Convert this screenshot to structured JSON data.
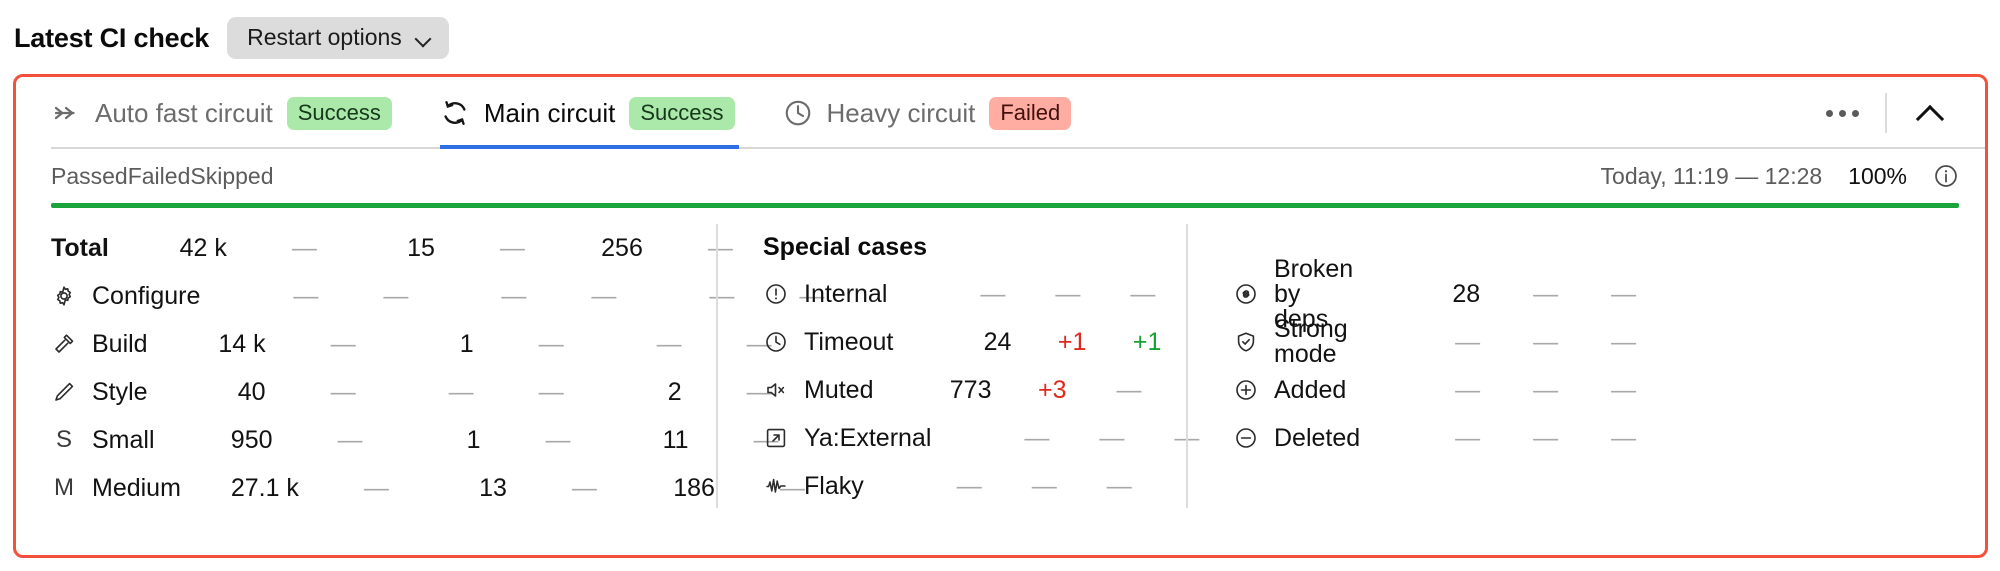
{
  "header": {
    "title": "Latest CI check",
    "restart_button": "Restart options",
    "chevron_icon": "chevron-down-icon"
  },
  "tabs": [
    {
      "label": "Auto fast circuit",
      "status": "Success",
      "status_type": "success",
      "icon": "double-chevron-right-icon",
      "active": false
    },
    {
      "label": "Main circuit",
      "status": "Success",
      "status_type": "success",
      "icon": "sync-circular-arrows-icon",
      "active": true
    },
    {
      "label": "Heavy circuit",
      "status": "Failed",
      "status_type": "failed",
      "icon": "clock-icon",
      "active": false
    }
  ],
  "tab_actions": {
    "more_icon": "more-horizontal-icon",
    "collapse_icon": "chevron-up-icon"
  },
  "meta": {
    "columns": [
      "Passed",
      "Failed",
      "Skipped"
    ],
    "time_range": "Today, 11:19 — 12:28",
    "percent": "100%",
    "info_icon": "info-circle-icon",
    "progress_color": "#19a33a",
    "progress_percent": 100
  },
  "colors": {
    "accent_border": "#f5503c",
    "active_tab": "#2f6fe4",
    "success_bg": "#abe9ab",
    "failed_bg": "#ffada3",
    "delta_up": "#e0281c",
    "delta_good": "#17a334"
  },
  "left_table": {
    "rows": [
      {
        "name": "Total",
        "icon": "",
        "letter": "",
        "bold": true,
        "cells": [
          "42 k",
          "—",
          "15",
          "—",
          "256",
          "—"
        ]
      },
      {
        "name": "Configure",
        "icon": "gear-icon",
        "letter": "",
        "bold": false,
        "cells": [
          "—",
          "—",
          "—",
          "—",
          "—",
          "—"
        ]
      },
      {
        "name": "Build",
        "icon": "hammer-icon",
        "letter": "",
        "bold": false,
        "cells": [
          "14 k",
          "—",
          "1",
          "—",
          "—",
          "—"
        ]
      },
      {
        "name": "Style",
        "icon": "pencil-icon",
        "letter": "",
        "bold": false,
        "cells": [
          "40",
          "—",
          "—",
          "—",
          "2",
          "—"
        ]
      },
      {
        "name": "Small",
        "icon": "",
        "letter": "S",
        "bold": false,
        "cells": [
          "950",
          "—",
          "1",
          "—",
          "11",
          "—"
        ]
      },
      {
        "name": "Medium",
        "icon": "",
        "letter": "M",
        "bold": false,
        "cells": [
          "27.1 k",
          "—",
          "13",
          "—",
          "186",
          "—"
        ]
      }
    ]
  },
  "special_cases": {
    "title": "Special cases",
    "rows": [
      {
        "name": "Internal",
        "icon": "exclamation-circle-icon",
        "cells": [
          "—",
          "—",
          "—"
        ],
        "cell_styles": [
          "dash",
          "dash",
          "dash"
        ]
      },
      {
        "name": "Timeout",
        "icon": "clock-icon",
        "cells": [
          "24",
          "+1",
          "+1"
        ],
        "cell_styles": [
          "",
          "pos-red",
          "pos-green"
        ]
      },
      {
        "name": "Muted",
        "icon": "speaker-mute-icon",
        "cells": [
          "773",
          "+3",
          "—"
        ],
        "cell_styles": [
          "",
          "pos-red",
          "dash"
        ]
      },
      {
        "name": "Ya:External",
        "icon": "external-link-icon",
        "cells": [
          "—",
          "—",
          "—"
        ],
        "cell_styles": [
          "dash",
          "dash",
          "dash"
        ]
      },
      {
        "name": "Flaky",
        "icon": "waveform-icon",
        "cells": [
          "—",
          "—",
          "—"
        ],
        "cell_styles": [
          "dash",
          "dash",
          "dash"
        ]
      }
    ]
  },
  "right_table": {
    "rows": [
      {
        "name": "Broken by deps",
        "icon": "link-chain-icon",
        "cells": [
          "28",
          "—",
          "—"
        ],
        "cell_styles": [
          "",
          "dash",
          "dash"
        ]
      },
      {
        "name": "Strong mode",
        "icon": "shield-check-icon",
        "cells": [
          "—",
          "—",
          "—"
        ],
        "cell_styles": [
          "dash",
          "dash",
          "dash"
        ]
      },
      {
        "name": "Added",
        "icon": "plus-circle-icon",
        "cells": [
          "—",
          "—",
          "—"
        ],
        "cell_styles": [
          "dash",
          "dash",
          "dash"
        ]
      },
      {
        "name": "Deleted",
        "icon": "minus-circle-icon",
        "cells": [
          "—",
          "—",
          "—"
        ],
        "cell_styles": [
          "dash",
          "dash",
          "dash"
        ]
      }
    ]
  }
}
